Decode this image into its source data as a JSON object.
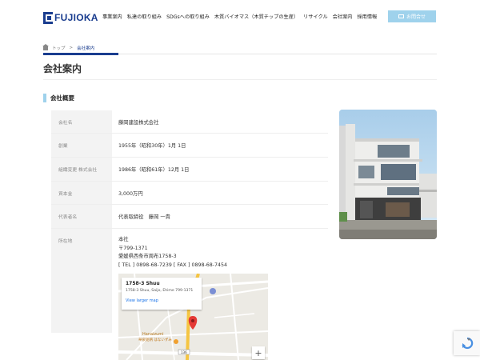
{
  "header": {
    "logo_text": "FUJIOKA",
    "nav": [
      "事業案内",
      "私達の取り組み",
      "SDGsへの取り組み",
      "木質バイオマス（木質チップの生産）",
      "リサイクル",
      "会社案内",
      "採用情報"
    ],
    "contact_label": "お問合せ",
    "accent_color": "#1a3d8f",
    "button_color": "#9fd2ec"
  },
  "breadcrumb": {
    "home": "トップ",
    "separator": ">",
    "current": "会社案内"
  },
  "page_title": "会社案内",
  "section_title": "会社概要",
  "company_table": [
    {
      "label": "会社名",
      "value": "藤岡建設株式会社"
    },
    {
      "label": "創業",
      "value": "1955年（昭和30年）1月 1日"
    },
    {
      "label": "組織変更 株式会社",
      "value": "1986年（昭和61年）12月 1日"
    },
    {
      "label": "資本金",
      "value": "3,000万円"
    },
    {
      "label": "代表者名",
      "value": "代表取締役　藤岡 一貴"
    }
  ],
  "address": {
    "label": "所在地",
    "office": "本社",
    "postal": "〒799-1371",
    "street": "愛媛県西条市周布1758-3",
    "contact": "[ TEL ] 0898-68-7239 [ FAX ] 0898-68-7454"
  },
  "map": {
    "card_title": "1758-3 Shuu",
    "card_address": "1758-3 Shuu, Saijo, Ehime 799-1371",
    "card_link": "View larger map",
    "place_label": "Hanaizumi",
    "place_label_jp": "華泉銘柄 はないずみ",
    "road_number": "136",
    "zoom_in": "+"
  }
}
